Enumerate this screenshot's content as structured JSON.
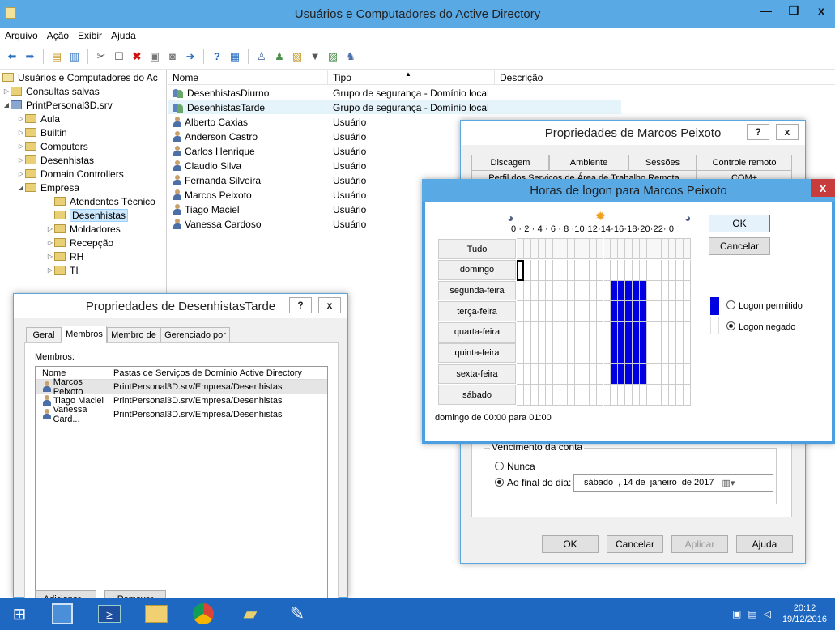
{
  "window": {
    "title": "Usuários e Computadores do Active Directory"
  },
  "menu": [
    "Arquivo",
    "Ação",
    "Exibir",
    "Ajuda"
  ],
  "tree": {
    "root": "Usuários e Computadores do Ac",
    "saved": "Consultas salvas",
    "domain": "PrintPersonal3D.srv",
    "items": [
      "Aula",
      "Builtin",
      "Computers",
      "Desenhistas",
      "Domain Controllers",
      "Empresa"
    ],
    "empresa_children": [
      "Atendentes Técnico",
      "Desenhistas",
      "Moldadores",
      "Recepção",
      "RH",
      "TI"
    ]
  },
  "list": {
    "headers": [
      "Nome",
      "Tipo",
      "Descrição"
    ],
    "rows": [
      {
        "name": "DesenhistasDiurno",
        "type": "Grupo de segurança - Domínio local"
      },
      {
        "name": "DesenhistasTarde",
        "type": "Grupo de segurança - Domínio local"
      },
      {
        "name": "Alberto Caxias",
        "type": "Usuário"
      },
      {
        "name": "Anderson Castro",
        "type": "Usuário"
      },
      {
        "name": "Carlos Henrique",
        "type": "Usuário"
      },
      {
        "name": "Claudio Silva",
        "type": "Usuário"
      },
      {
        "name": "Fernanda Silveira",
        "type": "Usuário"
      },
      {
        "name": "Marcos Peixoto",
        "type": "Usuário"
      },
      {
        "name": "Tiago Maciel",
        "type": "Usuário"
      },
      {
        "name": "Vanessa Cardoso",
        "type": "Usuário"
      }
    ]
  },
  "group_dialog": {
    "title": "Propriedades de DesenhistasTarde",
    "help": "?",
    "close": "x",
    "tabs": [
      "Geral",
      "Membros",
      "Membro de",
      "Gerenciado por"
    ],
    "members_label": "Membros:",
    "col_name": "Nome",
    "col_folder": "Pastas de Serviços de Domínio Active Directory",
    "members": [
      {
        "name": "Marcos Peixoto",
        "folder": "PrintPersonal3D.srv/Empresa/Desenhistas"
      },
      {
        "name": "Tiago Maciel",
        "folder": "PrintPersonal3D.srv/Empresa/Desenhistas"
      },
      {
        "name": "Vanessa Card...",
        "folder": "PrintPersonal3D.srv/Empresa/Desenhistas"
      }
    ],
    "add": "Adicionar...",
    "remove": "Remover"
  },
  "user_dialog": {
    "title": "Propriedades de Marcos Peixoto",
    "help": "?",
    "close": "x",
    "tabs_row1": [
      "Discagem",
      "Ambiente",
      "Sessões",
      "Controle remoto"
    ],
    "tabs_row2": [
      "Perfil dos Serviços de Área de Trabalho Remota",
      "COM+"
    ],
    "expiry_label": "Vencimento da conta",
    "never": "Nunca",
    "end_of_day": "Ao final do dia:",
    "date": {
      "weekday": "sábado",
      "day": ", 14 de",
      "month": "janeiro",
      "year": "de 2017"
    },
    "ok": "OK",
    "cancel": "Cancelar",
    "apply": "Aplicar",
    "help_btn": "Ajuda"
  },
  "logon_dialog": {
    "title": "Horas de logon para Marcos Peixoto",
    "close": "x",
    "hours_scale": "0 · 2 · 4 · 6 · 8 ·10·12·14·16·18·20·22· 0",
    "all": "Tudo",
    "days": [
      "domingo",
      "segunda-feira",
      "terça-feira",
      "quarta-feira",
      "quinta-feira",
      "sexta-feira",
      "sábado"
    ],
    "allowed_hours": {
      "start": 13,
      "end": 18,
      "days": [
        1,
        2,
        3,
        4,
        5,
        6
      ]
    },
    "selected_cell": {
      "day": 0,
      "hour": 0
    },
    "ok": "OK",
    "cancel": "Cancelar",
    "permitted": "Logon permitido",
    "denied": "Logon negado",
    "status": "domingo de 00:00 para 01:00"
  },
  "taskbar": {
    "time": "20:12",
    "date": "19/12/2016"
  },
  "colors": {
    "titlebar": "#59a9e5",
    "taskbar": "#1e68c2",
    "allowed": "#0000e0"
  }
}
